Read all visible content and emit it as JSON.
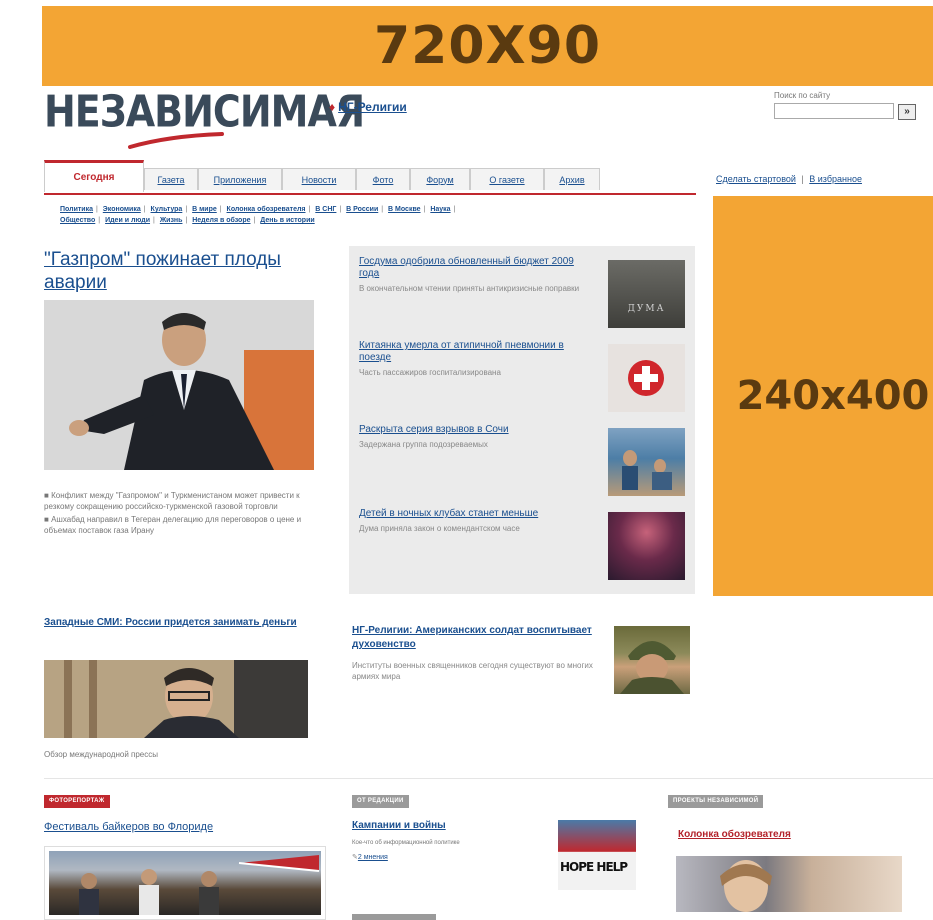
{
  "banner_top": {
    "label": "720X90"
  },
  "logo": {
    "text": "НЕЗАВИСИМАЯ"
  },
  "ng_link": {
    "label": "НГ-Религии"
  },
  "search": {
    "label": "Поиск по сайту",
    "button": "»"
  },
  "tabs": [
    {
      "label": "Сегодня",
      "active": true
    },
    {
      "label": "Газета"
    },
    {
      "label": "Приложения"
    },
    {
      "label": "Новости"
    },
    {
      "label": "Фото"
    },
    {
      "label": "Форум"
    },
    {
      "label": "О газете"
    },
    {
      "label": "Архив"
    }
  ],
  "top_right": {
    "make_home": "Сделать стартовой",
    "sep": "|",
    "favorites": "В избранное"
  },
  "subnav": {
    "row1": [
      "Политика",
      "Экономика",
      "Культура",
      "В мире",
      "Колонка обозревателя",
      "В СНГ",
      "В России",
      "В Москве",
      "Наука"
    ],
    "row2": [
      "Общество",
      "Идеи и люди",
      "Жизнь",
      "Неделя в обзоре",
      "День в истории"
    ],
    "sep": "|"
  },
  "main": {
    "headline": "\"Газпром\" пожинает плоды аварии",
    "bullets": [
      "Конфликт между \"Газпромом\" и Туркменистаном может привести к резкому сокращению российско-туркменской газовой торговли",
      "Ашхабад направил в Тегеран делегацию для переговоров о цене и объемах поставок газа Ирану"
    ],
    "bullet_mark": "■"
  },
  "secondary": {
    "headline": "Западные СМИ: России придется занимать деньги",
    "caption": "Обзор международной прессы"
  },
  "panel_items": [
    {
      "title": "Госдума одобрила обновленный бюджет 2009 года",
      "desc": "В окончательном чтении приняты антикризисные поправки",
      "thumb_text": "ДУМА"
    },
    {
      "title": "Китаянка умерла от атипичной пневмонии в поезде",
      "desc": "Часть пассажиров госпитализирована"
    },
    {
      "title": "Раскрыта серия взрывов в Сочи",
      "desc": "Задержана группа подозреваемых"
    },
    {
      "title": "Детей в ночных клубах станет меньше",
      "desc": "Дума приняла закон о комендантском часе"
    }
  ],
  "religion": {
    "title": "НГ-Религии: Американских солдат воспитывает духовенство",
    "desc": "Институты военных священников сегодня существуют во многих армиях мира"
  },
  "banner_side": {
    "label": "240x400"
  },
  "bottom": {
    "col1": {
      "badge": "ФОТОРЕПОРТАЖ",
      "title": "Фестиваль байкеров во Флориде"
    },
    "col2": {
      "badge": "ОТ РЕДАКЦИИ",
      "title": "Кампании и войны",
      "desc": "Кое-что об информационной политике",
      "comments": "2 мнения",
      "thumb_text": "HOPE HELP"
    },
    "col3": {
      "badge": "ПРОЕКТЫ НЕЗАВИСИМОЙ",
      "title": "Колонка обозревателя"
    }
  },
  "colors": {
    "orange": "#f3a534",
    "red": "#c0282e",
    "link": "#1a4f8f"
  }
}
